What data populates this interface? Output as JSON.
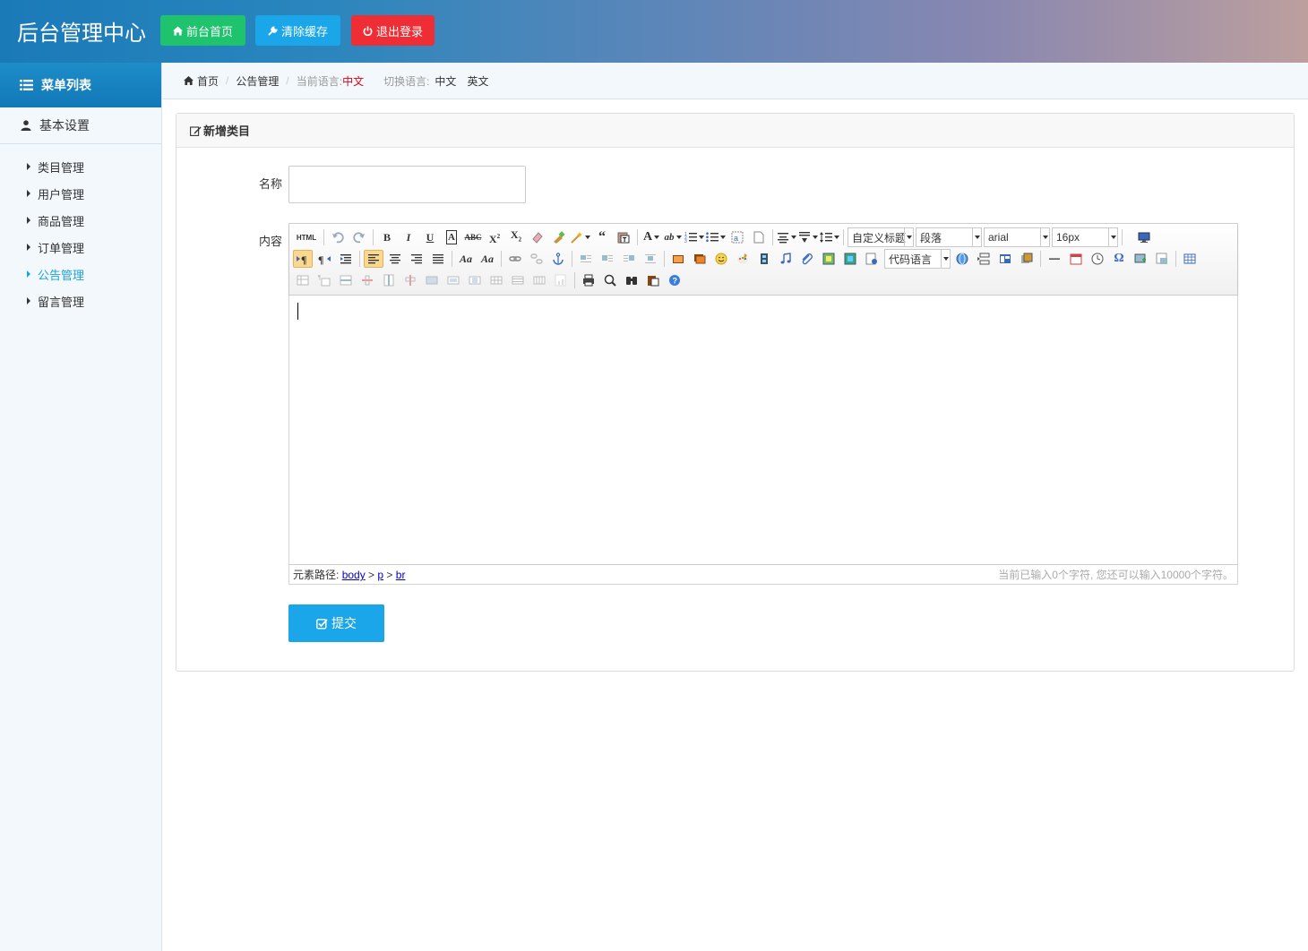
{
  "header": {
    "brand": "后台管理中心",
    "buttons": {
      "home": "前台首页",
      "clear_cache": "清除缓存",
      "logout": "退出登录"
    },
    "colors": {
      "home": "#1fc36e",
      "clear_cache": "#1aa6e8",
      "logout": "#ef2d35"
    }
  },
  "sidebar": {
    "title": "菜单列表",
    "group": "基本设置",
    "items": [
      {
        "label": "类目管理",
        "active": false
      },
      {
        "label": "用户管理",
        "active": false
      },
      {
        "label": "商品管理",
        "active": false
      },
      {
        "label": "订单管理",
        "active": false
      },
      {
        "label": "公告管理",
        "active": true
      },
      {
        "label": "留言管理",
        "active": false
      }
    ]
  },
  "breadcrumb": {
    "home": "首页",
    "current": "公告管理",
    "lang_label": "当前语言:",
    "lang_value": "中文",
    "switch_label": "切换语言:",
    "options": [
      "中文",
      "英文"
    ]
  },
  "panel": {
    "title": "新增类目",
    "name_label": "名称",
    "name_value": "",
    "content_label": "内容",
    "submit": "提交"
  },
  "editor": {
    "html_btn": "HTML",
    "selects": {
      "heading": "自定义标题",
      "paragraph": "段落",
      "font": "arial",
      "size": "16px",
      "code": "代码语言"
    },
    "path_label": "元素路径:",
    "path": [
      "body",
      "p",
      "br"
    ],
    "count_text": "当前已输入0个字符, 您还可以输入10000个字符。"
  }
}
